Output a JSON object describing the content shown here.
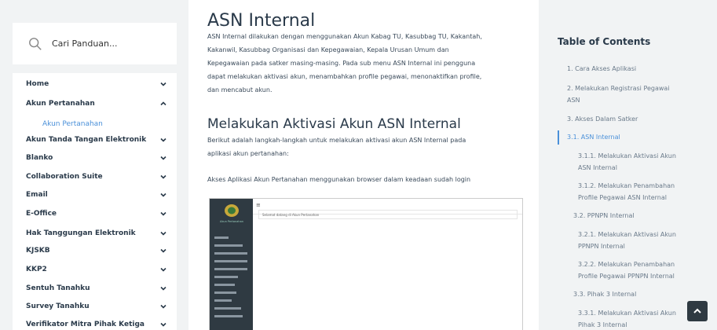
{
  "search": {
    "placeholder": "Cari Panduan..."
  },
  "nav": {
    "items": [
      {
        "label": "Home",
        "expanded": false
      },
      {
        "label": "Akun Pertanahan",
        "expanded": true
      },
      {
        "label": "Akun Tanda Tangan Elektronik",
        "expanded": false
      },
      {
        "label": "Blanko",
        "expanded": false
      },
      {
        "label": "Collaboration Suite",
        "expanded": false
      },
      {
        "label": "Email",
        "expanded": false
      },
      {
        "label": "E-Office",
        "expanded": false
      },
      {
        "label": "Hak Tanggungan Elektronik",
        "expanded": false
      },
      {
        "label": "KJSKB",
        "expanded": false
      },
      {
        "label": "KKP2",
        "expanded": false
      },
      {
        "label": "Sentuh Tanahku",
        "expanded": false
      },
      {
        "label": "Survey Tanahku",
        "expanded": false
      },
      {
        "label": "Verifikator Mitra Pihak Ketiga",
        "expanded": false
      }
    ],
    "sub_item": "Akun Pertanahan"
  },
  "main": {
    "title": "ASN Internal",
    "intro_lines": [
      "ASN Internal dilakukan dengan menggunakan Akun Kabag TU, Kasubbag TU, Kakantah,",
      "Kakanwil, Kasubbag Organisasi dan Kepegawaian, Kepala Urusan Umum dan",
      "Kepegawaian pada satker masing-masing. Pada sub menu ASN Internal ini pengguna",
      "dapat melakukan aktivasi akun, menambahkan profile pegawai, menonaktifkan profile,",
      "dan mencabut akun."
    ],
    "section_title": "Melakukan Aktivasi Akun ASN Internal",
    "section_lines": [
      "Berikut adalah langkah-langkah untuk melakukan aktivasi akun ASN Internal pada",
      "aplikasi akun pertanahan:"
    ],
    "note": "Akses Aplikasi Akun Pertanahan menggunakan browser dalam keadaan sudah login",
    "screenshot": {
      "logo_text": "Akun Pertanahan",
      "welcome": "Selamat datang di Akun Pertanahan",
      "hamburger": "≡"
    }
  },
  "toc": {
    "title": "Table of Contents",
    "items": [
      "1. Cara Akses Aplikasi",
      "2. Melakukan Registrasi Pegawai",
      "ASN",
      "3. Akses Dalam Satker",
      "3.1. ASN Internal",
      "3.1.1. Melakukan Aktivasi Akun",
      "ASN Internal",
      "3.1.2. Melakukan Penambahan",
      "Profile Pegawai ASN Internal",
      "3.2. PPNPN Internal",
      "3.2.1. Melakukan Aktivasi Akun",
      "PPNPN Internal",
      "3.2.2. Melakukan Penambahan",
      "Profile Pegawai PPNPN Internal",
      "3.3. Pihak 3 Internal",
      "3.3.1. Melakukan Aktivasi Akun",
      "Pihak 3 Internal"
    ]
  }
}
